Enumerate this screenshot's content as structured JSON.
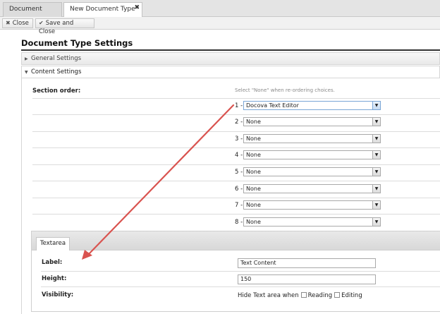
{
  "tabs": [
    {
      "label": "Document Types",
      "active": false
    },
    {
      "label": "New Document Type",
      "active": true
    }
  ],
  "toolbar": {
    "close_label": "Close",
    "save_close_label": "Save and Close"
  },
  "page_title": "Document Type Settings",
  "accordion": {
    "general": "General Settings",
    "content": "Content Settings"
  },
  "section_order": {
    "label": "Section order:",
    "hint": "Select \"None\" when re-ordering choices.",
    "rows": [
      {
        "num": "1 -",
        "value": "Docova Text Editor"
      },
      {
        "num": "2 -",
        "value": "None"
      },
      {
        "num": "3 -",
        "value": "None"
      },
      {
        "num": "4 -",
        "value": "None"
      },
      {
        "num": "5 -",
        "value": "None"
      },
      {
        "num": "6 -",
        "value": "None"
      },
      {
        "num": "7 -",
        "value": "None"
      },
      {
        "num": "8 -",
        "value": "None"
      }
    ]
  },
  "textarea_panel": {
    "tab": "Textarea",
    "label_field": {
      "label": "Label:",
      "value": "Text Content"
    },
    "height_field": {
      "label": "Height:",
      "value": "150"
    },
    "visibility": {
      "label": "Visibility:",
      "prefix": "Hide Text area when",
      "reading": "Reading",
      "editing": "Editing"
    }
  },
  "colors": {
    "annotation_arrow": "#d9534f"
  }
}
